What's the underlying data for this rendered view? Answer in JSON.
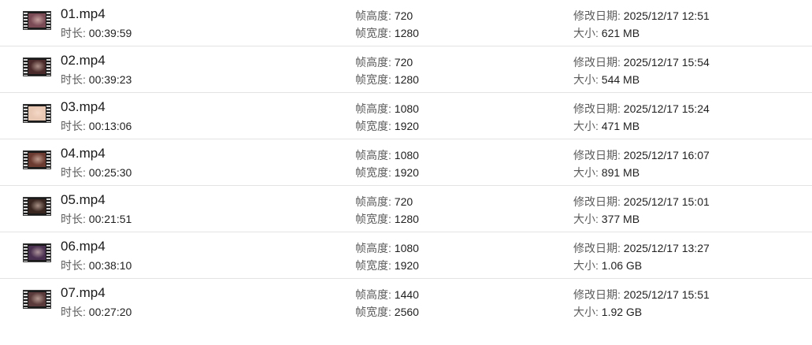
{
  "labels": {
    "duration": "时长: ",
    "frame_height": "帧高度: ",
    "frame_width": "帧宽度: ",
    "modified": "修改日期: ",
    "size": "大小: "
  },
  "files": [
    {
      "name": "01.mp4",
      "duration": "00:39:59",
      "frame_height": "720",
      "frame_width": "1280",
      "modified": "2025/12/17 12:51",
      "size": "621 MB",
      "thumb_color": "#7a4a55",
      "thumb_icon": "video-thumbnail-icon"
    },
    {
      "name": "02.mp4",
      "duration": "00:39:23",
      "frame_height": "720",
      "frame_width": "1280",
      "modified": "2025/12/17 15:54",
      "size": "544 MB",
      "thumb_color": "#4a2a2a",
      "thumb_icon": "video-thumbnail-icon"
    },
    {
      "name": "03.mp4",
      "duration": "00:13:06",
      "frame_height": "1080",
      "frame_width": "1920",
      "modified": "2025/12/17 15:24",
      "size": "471 MB",
      "thumb_color": "#e8c7b3",
      "thumb_icon": "video-thumbnail-icon"
    },
    {
      "name": "04.mp4",
      "duration": "00:25:30",
      "frame_height": "1080",
      "frame_width": "1920",
      "modified": "2025/12/17 16:07",
      "size": "891 MB",
      "thumb_color": "#6b3a30",
      "thumb_icon": "video-thumbnail-icon"
    },
    {
      "name": "05.mp4",
      "duration": "00:21:51",
      "frame_height": "720",
      "frame_width": "1280",
      "modified": "2025/12/17 15:01",
      "size": "377 MB",
      "thumb_color": "#3a2620",
      "thumb_icon": "video-thumbnail-icon"
    },
    {
      "name": "06.mp4",
      "duration": "00:38:10",
      "frame_height": "1080",
      "frame_width": "1920",
      "modified": "2025/12/17 13:27",
      "size": "1.06 GB",
      "thumb_color": "#4a3050",
      "thumb_icon": "video-thumbnail-icon"
    },
    {
      "name": "07.mp4",
      "duration": "00:27:20",
      "frame_height": "1440",
      "frame_width": "2560",
      "modified": "2025/12/17 15:51",
      "size": "1.92 GB",
      "thumb_color": "#5a3a3a",
      "thumb_icon": "video-thumbnail-icon"
    }
  ]
}
